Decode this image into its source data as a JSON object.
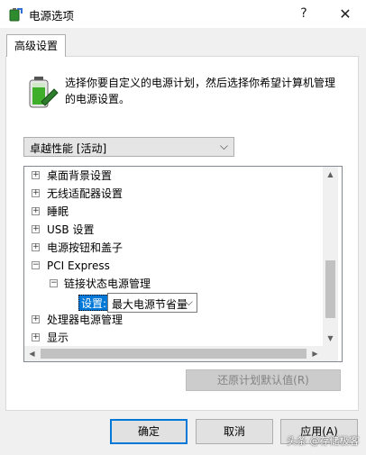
{
  "window": {
    "title": "电源选项",
    "help_glyph": "?",
    "close_glyph": "✕"
  },
  "tab": {
    "label": "高级设置"
  },
  "description": "选择你要自定义的电源计划，然后选择你希望计算机管理的电源设置。",
  "plan_select": {
    "value": "卓越性能 [活动]"
  },
  "tree": {
    "items": [
      {
        "label": "桌面背景设置",
        "expander": "+"
      },
      {
        "label": "无线适配器设置",
        "expander": "+"
      },
      {
        "label": "睡眠",
        "expander": "+"
      },
      {
        "label": "USB 设置",
        "expander": "+"
      },
      {
        "label": "电源按钮和盖子",
        "expander": "+"
      },
      {
        "label": "PCI Express",
        "expander": "−"
      },
      {
        "label": "链接状态电源管理",
        "expander": "−"
      },
      {
        "label": "处理器电源管理",
        "expander": "+"
      },
      {
        "label": "显示",
        "expander": "+"
      }
    ],
    "setting_label": "设置:",
    "setting_value": "最大电源节省量"
  },
  "buttons": {
    "restore": "还原计划默认值(R)",
    "ok": "确定",
    "cancel": "取消",
    "apply": "应用(A)"
  },
  "watermark": "头条 @存储极客",
  "colors": {
    "accent": "#0078d7",
    "dialog_bg": "#f0f0f0",
    "battery_green": "#3fae2a"
  }
}
